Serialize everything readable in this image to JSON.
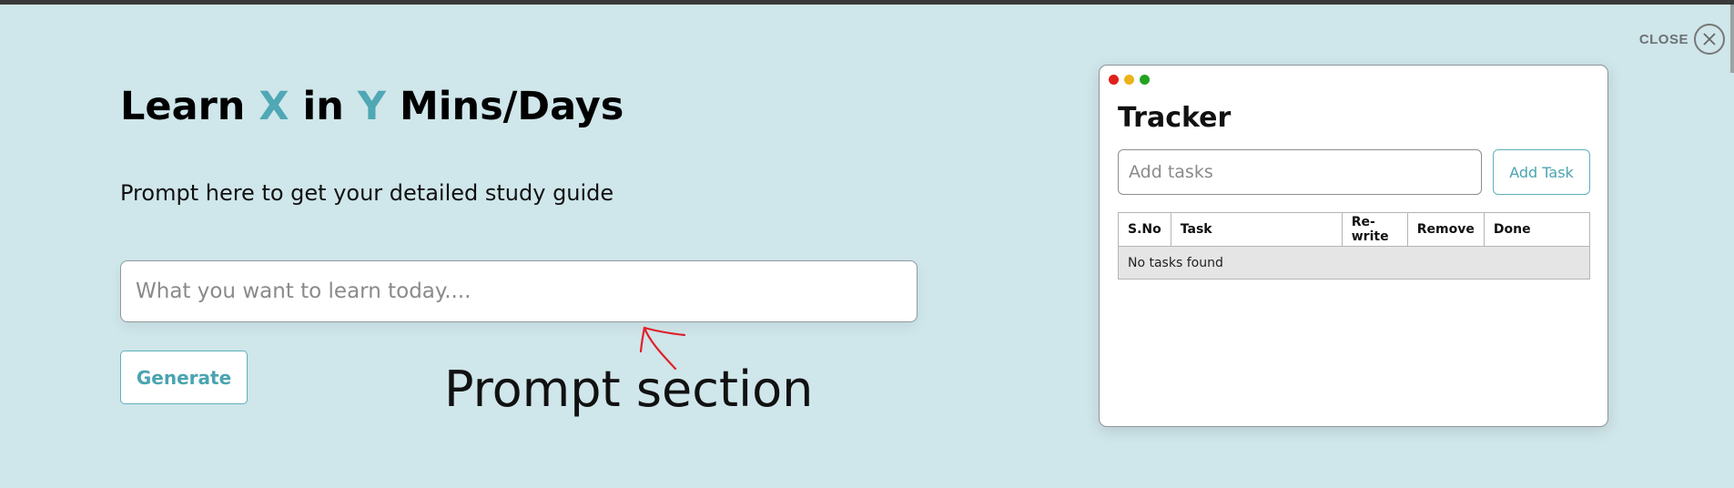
{
  "header": {
    "heading_prefix": "Learn ",
    "heading_x": "X",
    "heading_mid": " in ",
    "heading_y": "Y",
    "heading_suffix": " Mins/Days",
    "subtitle": "Prompt here to get your detailed study guide"
  },
  "prompt": {
    "placeholder": "What you want to learn today....",
    "value": "",
    "generate_label": "Generate"
  },
  "annotation": {
    "text": "Prompt section",
    "color": "#e0202a"
  },
  "close": {
    "label": "CLOSE",
    "icon": "close-icon"
  },
  "tracker": {
    "title": "Tracker",
    "window_controls": [
      "red-dot",
      "yellow-dot",
      "green-dot"
    ],
    "input_placeholder": "Add tasks",
    "input_value": "",
    "add_label": "Add Task",
    "columns": [
      "S.No",
      "Task",
      "Re-write",
      "Remove",
      "Done"
    ],
    "empty_message": "No tasks found"
  },
  "colors": {
    "background": "#cfe6ea",
    "accent": "#4fa8b4"
  }
}
